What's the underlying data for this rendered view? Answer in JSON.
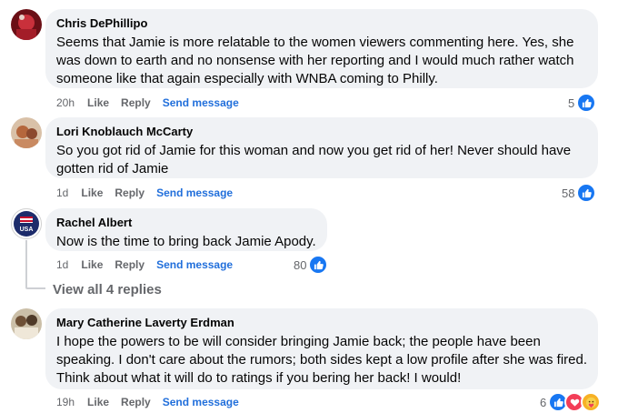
{
  "comments": [
    {
      "author": "Chris DePhillipo",
      "text": "Seems that Jamie is more relatable to the women viewers commenting here. Yes, she was down to earth and no nonsense with her reporting and I would much rather watch someone like that again especially with WNBA coming to Philly.",
      "time": "20h",
      "like": "Like",
      "reply": "Reply",
      "send": "Send message",
      "count": "5",
      "avatar_color": "#b3202c"
    },
    {
      "author": "Lori Knoblauch McCarty",
      "text": "So you got rid of Jamie for this woman and now you get rid of her! Never should have gotten rid of Jamie",
      "time": "1d",
      "like": "Like",
      "reply": "Reply",
      "send": "Send message",
      "count": "58",
      "avatar_color": "#a5523a"
    },
    {
      "author": "Rachel Albert",
      "text": "Now is the time to bring back Jamie Apody.",
      "time": "1d",
      "like": "Like",
      "reply": "Reply",
      "send": "Send message",
      "count": "80",
      "avatar_color": "#1d2c6b",
      "avatar_text": "USA"
    },
    {
      "author": "Mary Catherine Laverty Erdman",
      "text": "I hope the powers to be will consider bringing Jamie back; the people have been speaking. I don't care about the rumors; both sides kept a low profile after she was fired. Think about what it will do to ratings if you bering her back! I would!",
      "time": "19h",
      "like": "Like",
      "reply": "Reply",
      "send": "Send message",
      "count": "6",
      "avatar_color": "#8a6f52"
    }
  ],
  "view_replies": "View all 4 replies",
  "colors": {
    "like": "#1877f2",
    "love": "#f33e58",
    "care": "#f7b125",
    "link": "#216fdb"
  },
  "icons": [
    "like-icon",
    "love-icon",
    "care-icon"
  ]
}
